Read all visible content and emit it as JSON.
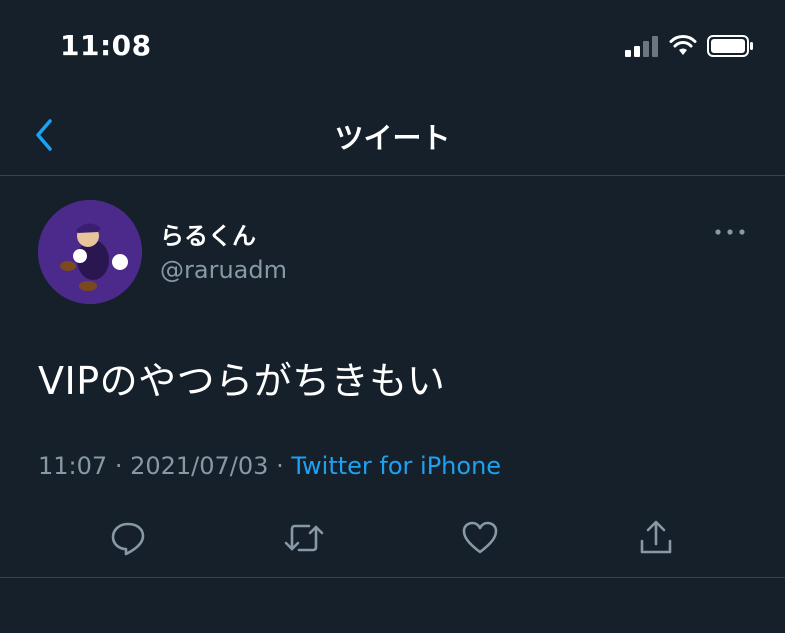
{
  "status_bar": {
    "time": "11:08",
    "signal_icon": "cellular-signal-icon",
    "wifi_icon": "wifi-icon",
    "battery_icon": "battery-icon"
  },
  "nav": {
    "title": "ツイート",
    "back_icon": "chevron-left-icon"
  },
  "tweet": {
    "display_name": "らるくん",
    "handle": "@raruadm",
    "text": "VIPのやつらがちきもい",
    "time": "11:07",
    "separator": "·",
    "date": "2021/07/03",
    "source": "Twitter for iPhone",
    "more_icon": "more-horizontal-icon"
  },
  "actions": [
    {
      "name": "reply",
      "icon": "reply-bubble-icon"
    },
    {
      "name": "retweet",
      "icon": "retweet-icon"
    },
    {
      "name": "like",
      "icon": "heart-icon"
    },
    {
      "name": "share",
      "icon": "share-icon"
    }
  ],
  "colors": {
    "background": "#15202b",
    "accent": "#1da1f2",
    "secondary_text": "#8899a6",
    "divider": "#38444d"
  }
}
